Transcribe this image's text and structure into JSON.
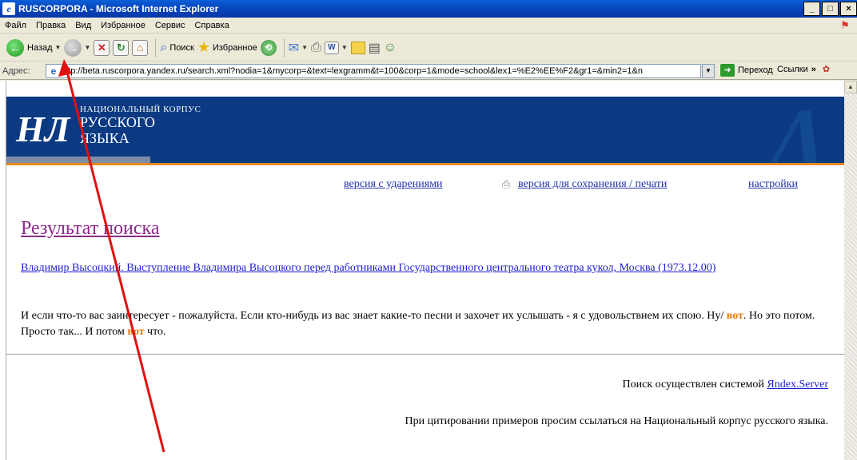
{
  "window": {
    "title": "RUSCORPORA - Microsoft Internet Explorer",
    "controls": [
      "_",
      "□",
      "×"
    ]
  },
  "menu": [
    "Файл",
    "Правка",
    "Вид",
    "Избранное",
    "Сервис",
    "Справка"
  ],
  "toolbar": {
    "back_label": "Назад",
    "search_label": "Поиск",
    "favorites_label": "Избранное"
  },
  "address": {
    "label": "Адрес:",
    "url": "http://beta.ruscorpora.yandex.ru/search.xml?nodia=1&mycorp=&text=lexgramm&t=100&corp=1&mode=school&lex1=%E2%EE%F2&gr1=&min2=1&n",
    "go_label": "Переход",
    "links_label": "Ссылки"
  },
  "site": {
    "logo_text": "НЛ",
    "name_small": "НАЦИОНАЛЬНЫЙ КОРПУС",
    "name_line1": "РУССКОГО",
    "name_line2": "ЯЗЫКА"
  },
  "links": {
    "stressed": "версия с ударениями",
    "print": "версия для сохранения / печати",
    "settings": "настройки"
  },
  "result": {
    "title": "Результат поиска",
    "document_link": "Владимир Высоцкий. Выступление Владимира Высоцкого перед работниками Государственного центрального театра кукол, Москва (1973.12.00)",
    "snippet_part1": "И если что-то вас заинтересует - пожалуйста. Если кто-нибудь из вас знает какие-то песни и захочет их услышать - я с удовольствием их спою. Ну/ ",
    "hit1": "вот",
    "snippet_part2": ". Но это потом. Просто так... И потом ",
    "hit2": "вот",
    "snippet_part3": " что."
  },
  "footer": {
    "powered_prefix": "Поиск осуществлен системой ",
    "powered_link": "Яndex.Server",
    "citation": "При цитировании примеров просим ссылаться на Национальный корпус русского языка."
  },
  "colors": {
    "banner": "#0b3a82",
    "accent": "#e58a1f",
    "hit": "#e07a10",
    "annotation_arrow": "#e01010"
  }
}
